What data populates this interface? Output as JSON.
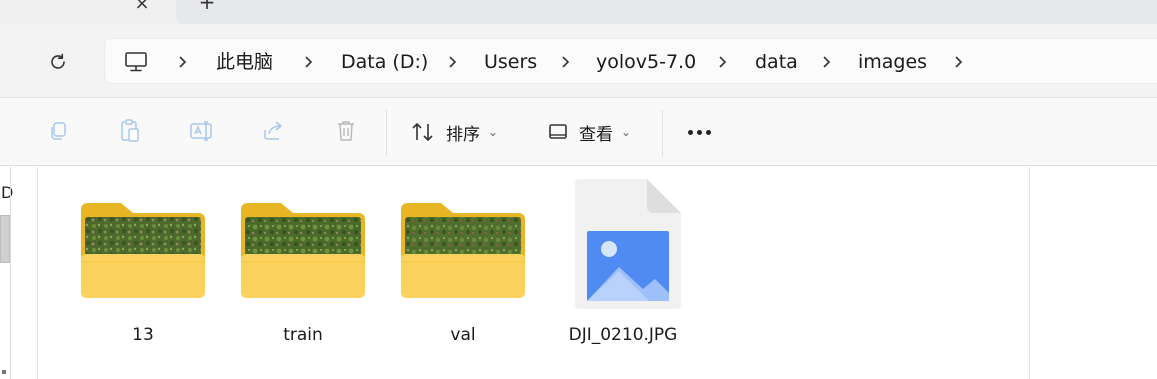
{
  "tabstrip": {
    "close_glyph": "×",
    "new_tab_glyph": "+"
  },
  "navigation": {
    "refresh_icon": "refresh-icon"
  },
  "breadcrumb": [
    {
      "label": "此电脑"
    },
    {
      "label": "Data (D:)"
    },
    {
      "label": "Users"
    },
    {
      "label": "yolov5-7.0"
    },
    {
      "label": "data"
    },
    {
      "label": "images"
    }
  ],
  "toolbar": {
    "sort_label": "排序",
    "view_label": "查看",
    "caret": "⌄"
  },
  "left_pane": {
    "letter": "D"
  },
  "items": [
    {
      "name": "13",
      "type": "folder"
    },
    {
      "name": "train",
      "type": "folder"
    },
    {
      "name": "val",
      "type": "folder"
    },
    {
      "name": "DJI_0210.JPG",
      "type": "image-file"
    }
  ],
  "colors": {
    "folder_back": "#e8b625",
    "folder_front": "#fcd25e",
    "photo_green": "#4f6e2e",
    "image_blue": "#4f8bf2",
    "file_page": "#f1f1f1"
  }
}
